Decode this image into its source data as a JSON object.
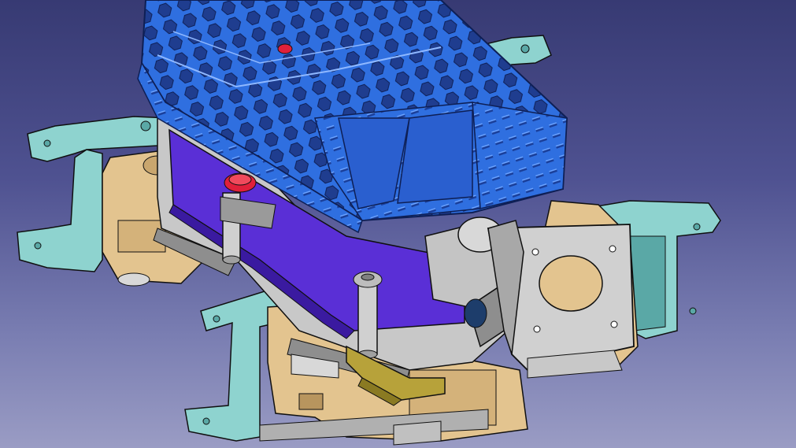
{
  "app": {
    "view": "3d-cad-viewport"
  },
  "colors": {
    "background_top": "#373a73",
    "background_bottom": "#9a9cc4",
    "heatsink": "#2f6fe0",
    "heatsink_dark": "#1f4fb0",
    "mount_arms": "#8ed3cf",
    "mount_arms_dark": "#5aa8a6",
    "bracket_tan": "#e3c48f",
    "bracket_tan_dark": "#b8955e",
    "metal_grey": "#c8c8c8",
    "metal_grey_dark": "#8e8e8e",
    "purple_plate": "#5a2fd6",
    "olive_clip": "#b7a23a",
    "red_screw": "#e0203a",
    "edge_lines": "#101010"
  },
  "icons": {
    "fan": "fan-hole-icon",
    "screw": "screw-head-icon"
  }
}
